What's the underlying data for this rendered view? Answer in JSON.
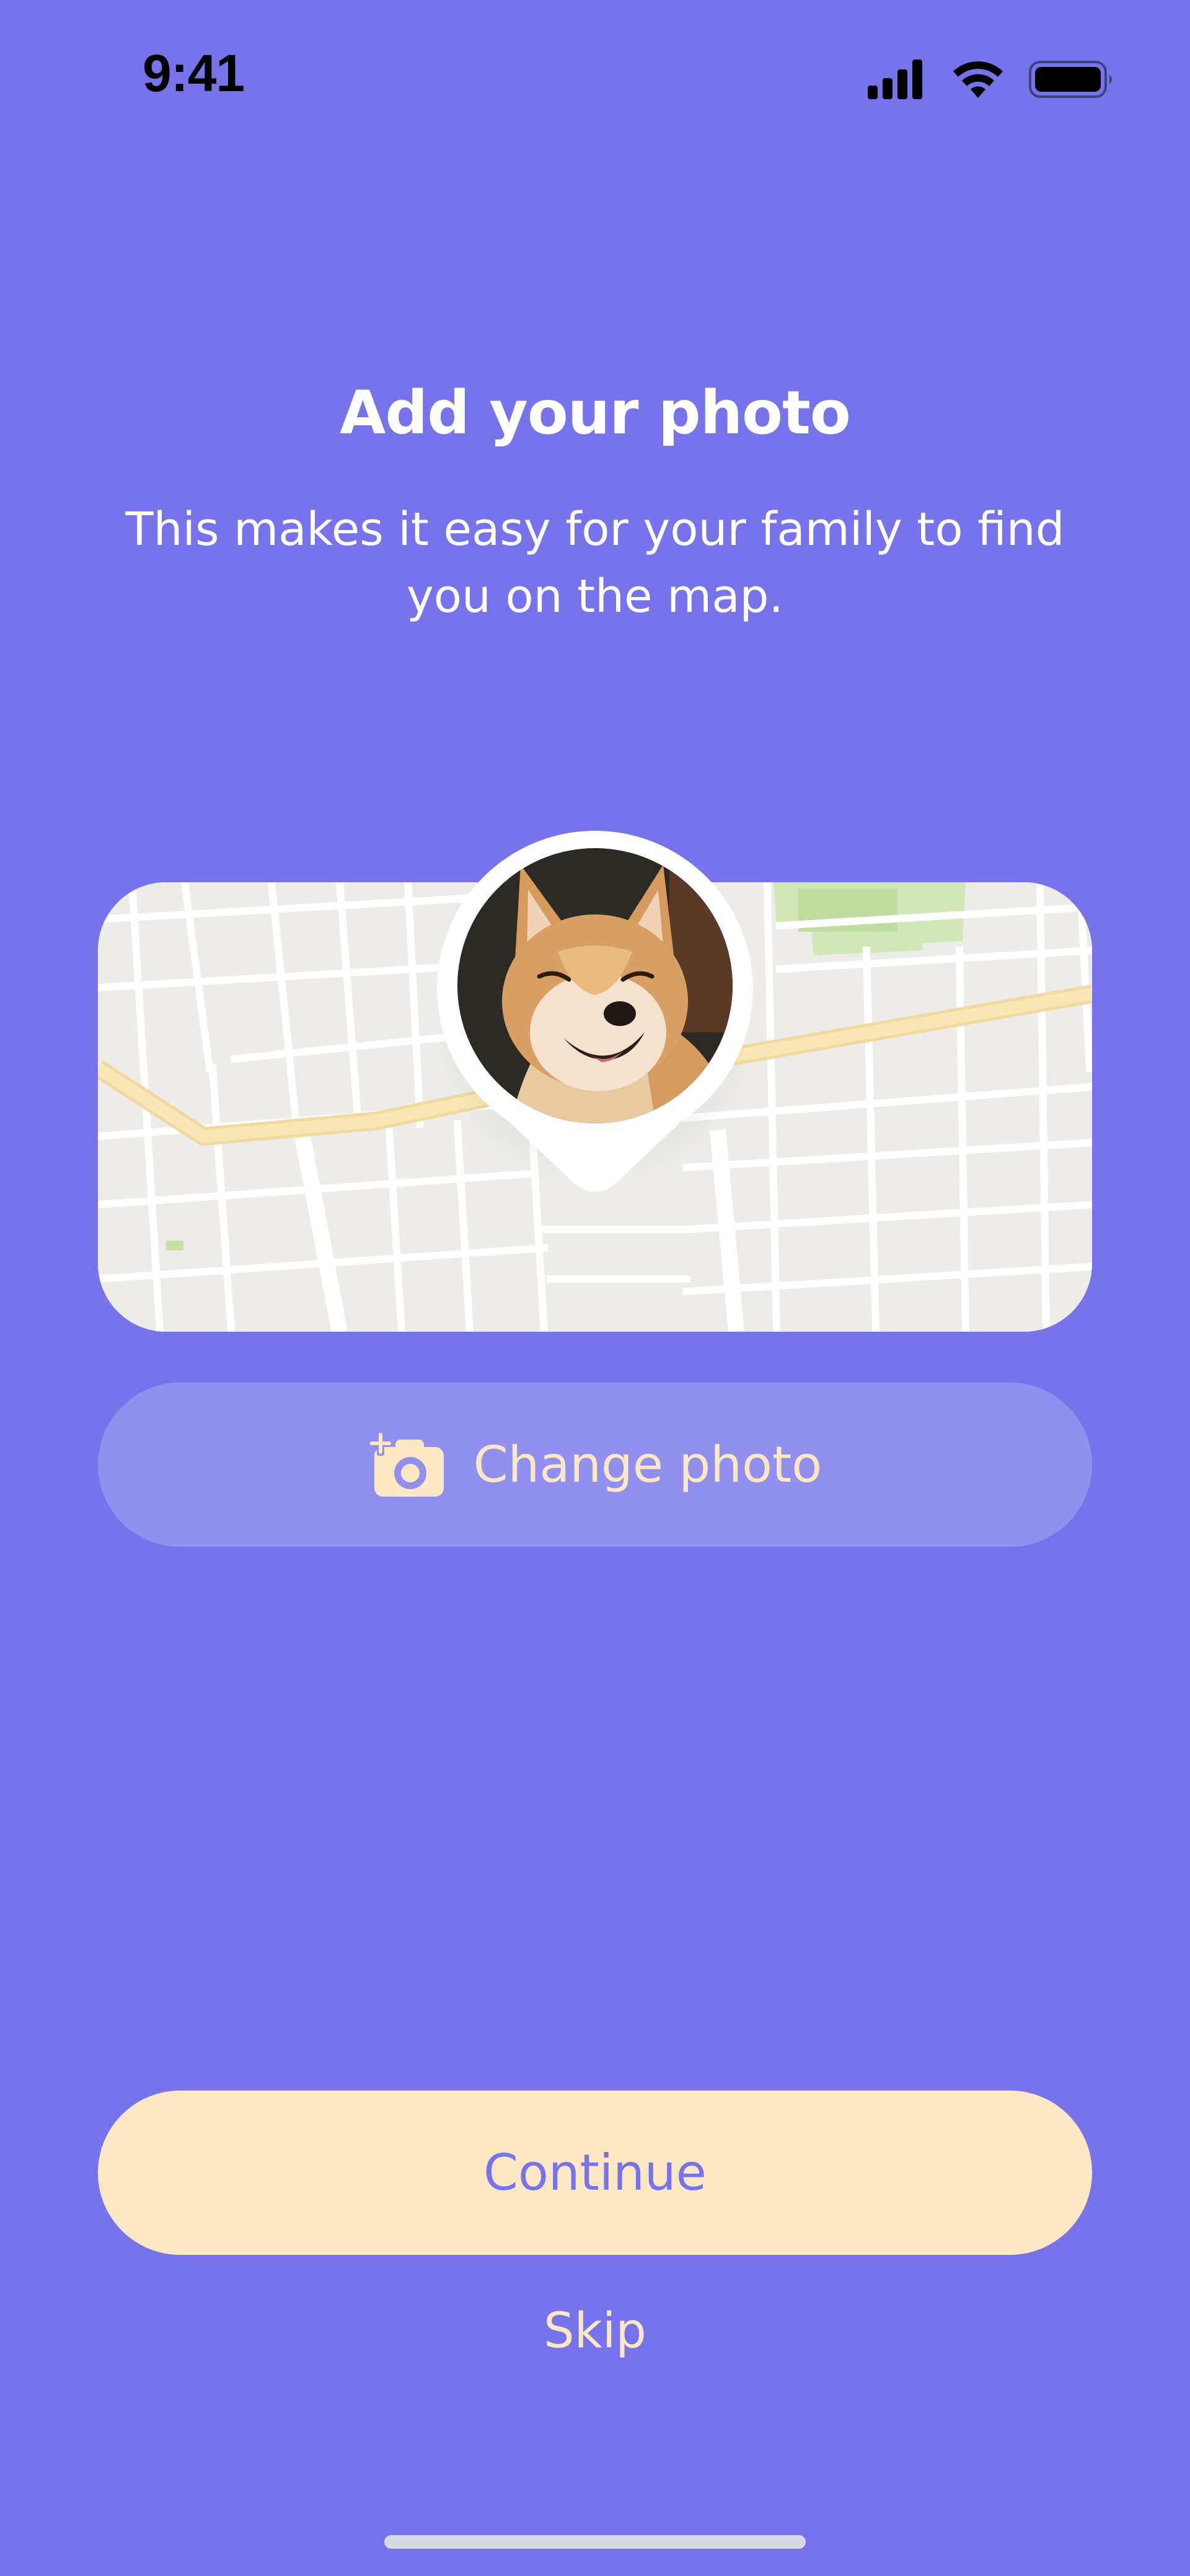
{
  "status_bar": {
    "time": "9:41",
    "icons": [
      "cellular-signal-icon",
      "wifi-icon",
      "battery-icon"
    ]
  },
  "header": {
    "title": "Add your photo",
    "subtitle": "This makes it easy for your family to find you on the map."
  },
  "map_preview": {
    "avatar_subject": "dog-photo",
    "pin_icon": "location-pin-icon"
  },
  "buttons": {
    "change_photo_label": "Change photo",
    "change_photo_icon": "add-photo-camera-icon",
    "continue_label": "Continue",
    "skip_label": "Skip"
  },
  "colors": {
    "background": "#7774EB",
    "accent_cream": "#FEE7C4",
    "secondary_button": "#9290EF"
  }
}
